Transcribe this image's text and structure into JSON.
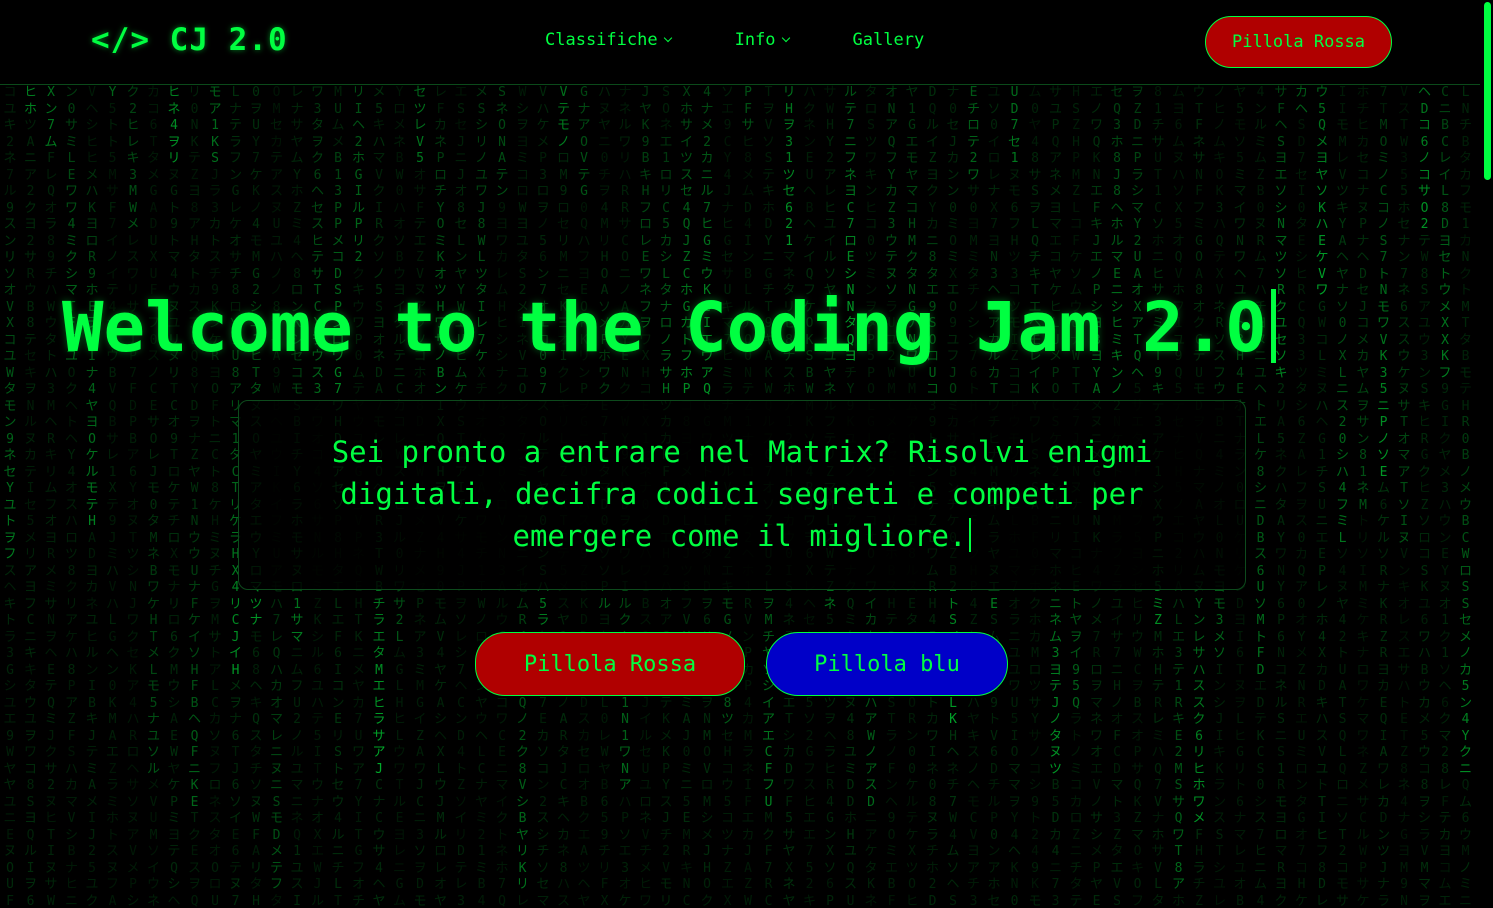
{
  "header": {
    "logo": "</> CJ 2.0",
    "nav": [
      {
        "label": "Classifiche",
        "has_dropdown": true
      },
      {
        "label": "Info",
        "has_dropdown": true
      },
      {
        "label": "Gallery",
        "has_dropdown": false
      }
    ],
    "cta_label": "Pillola Rossa"
  },
  "hero": {
    "title": "Welcome to the Coding Jam 2.0",
    "description": "Sei pronto a entrare nel Matrix? Risolvi enigmi digitali, decifra codici segreti e competi per emergere come il migliore.",
    "red_pill_label": "Pillola Rossa",
    "blue_pill_label": "Pillola blu"
  },
  "colors": {
    "matrix_green": "#00ff41",
    "red_pill": "#b00000",
    "blue_pill": "#0000c8",
    "background": "#000000"
  }
}
